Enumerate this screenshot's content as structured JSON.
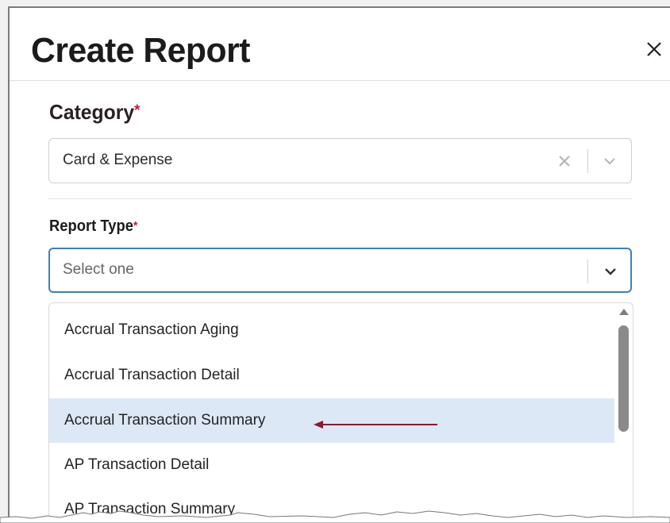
{
  "dialog": {
    "title": "Create Report",
    "close_icon": "close-icon"
  },
  "category": {
    "label": "Category",
    "required_mark": "*",
    "value": "Card & Expense",
    "clear_icon": "clear-x-icon",
    "chevron_icon": "chevron-down-icon"
  },
  "report_type": {
    "label": "Report Type",
    "required_mark": "*",
    "placeholder": "Select one",
    "chevron_icon": "chevron-down-icon"
  },
  "dropdown": {
    "options": [
      {
        "label": "Accrual Transaction Aging",
        "highlighted": false
      },
      {
        "label": "Accrual Transaction Detail",
        "highlighted": false
      },
      {
        "label": "Accrual Transaction Summary",
        "highlighted": true
      },
      {
        "label": "AP Transaction Detail",
        "highlighted": false
      },
      {
        "label": "AP Transaction Summary",
        "highlighted": false
      }
    ]
  },
  "annotation": {
    "arrow_color": "#8b1a2b"
  },
  "colors": {
    "focus_border": "#3d7fbf",
    "highlight_bg": "#dde8f7",
    "required": "#c0202a"
  }
}
